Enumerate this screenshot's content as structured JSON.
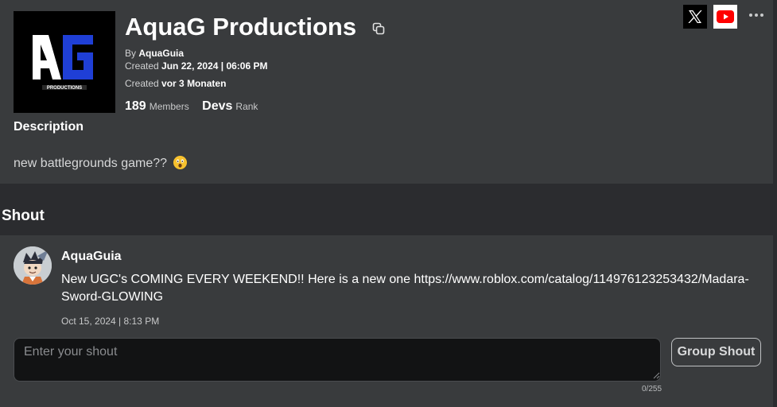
{
  "group": {
    "name": "AquaG Productions",
    "logo_letters": "AG",
    "logo_subtext": "PRODUCTIONS",
    "by_label": "By",
    "owner": "AquaGuia",
    "created_label": "Created",
    "created_date": "Jun 22, 2024 | 06:06 PM",
    "created_label2": "Created",
    "created_relative": "vor 3 Monaten",
    "members_count": "189",
    "members_label": "Members",
    "rank_value": "Devs",
    "rank_label": "Rank"
  },
  "description": {
    "heading": "Description",
    "text": "new battlegrounds game??"
  },
  "shout": {
    "heading": "Shout",
    "author": "AquaGuia",
    "message": "New UGC's COMING EVERY WEEKEND!! Here is a new one https://www.roblox.com/catalog/114976123253432/Madara-Sword-GLOWING",
    "timestamp": "Oct 15, 2024 | 8:13 PM",
    "input_placeholder": "Enter your shout",
    "input_value": "",
    "char_counter": "0/255",
    "submit_label": "Group Shout"
  },
  "icons": {
    "copy": "copy-icon",
    "x": "x-logo-icon",
    "youtube": "youtube-icon",
    "more": "more-options-icon",
    "emoji": "astonished-face-emoji"
  },
  "colors": {
    "page_background": "#2b2c2f",
    "panel_background": "#393b3d",
    "input_background": "#121314",
    "logo_blue": "#1f3fd6",
    "youtube_red": "#ff0000"
  }
}
